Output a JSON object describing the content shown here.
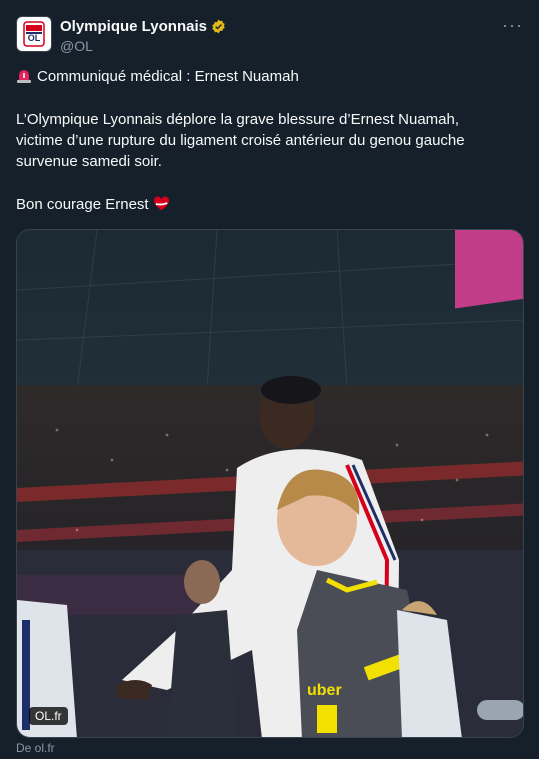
{
  "author": {
    "display_name": "Olympique Lyonnais",
    "handle": "@OL",
    "avatar_icon": "ol-crest-icon",
    "verified_icon": "verified-gold-badge-icon",
    "verified_color": "#e2b719"
  },
  "more_icon": "more-options-icon",
  "post": {
    "title": "Communiqué médical : Ernest Nuamah",
    "title_icon": "rotating-light-siren-icon",
    "body_line1": "L’Olympique Lyonnais déplore la grave blessure d’Ernest Nuamah,",
    "body_line2": "victime d’une rupture du ligament croisé antérieur du genou gauche",
    "body_line3": "survenue samedi soir.",
    "closing": "Bon courage Ernest",
    "closing_icon": "red-white-heart-icon"
  },
  "media": {
    "description_icon": "stadium-photo",
    "domain_label": "OL.fr",
    "jersey_text": "uber"
  },
  "link_source": "De ol.fr",
  "colors": {
    "background": "#15202b",
    "text": "#f7f9f9",
    "secondary": "#8b98a5",
    "border": "#38444d",
    "accent_red": "#e0245e"
  }
}
